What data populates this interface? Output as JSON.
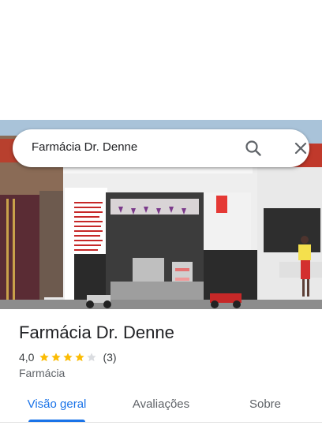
{
  "search": {
    "query": "Farmácia Dr. Denne",
    "search_icon": "search-icon",
    "close_icon": "close-icon"
  },
  "photo": {
    "subject": "pharmacy-storefront-photo"
  },
  "place": {
    "name": "Farmácia Dr. Denne",
    "rating": "4,0",
    "rating_value": 4.0,
    "rating_max": 5,
    "review_count": "(3)",
    "category": "Farmácia"
  },
  "tabs": [
    {
      "label": "Visão geral",
      "active": true
    },
    {
      "label": "Avaliações",
      "active": false
    },
    {
      "label": "Sobre",
      "active": false
    }
  ],
  "colors": {
    "accent": "#1a73e8",
    "star_filled": "#fbbc04",
    "star_empty": "#dadce0"
  }
}
